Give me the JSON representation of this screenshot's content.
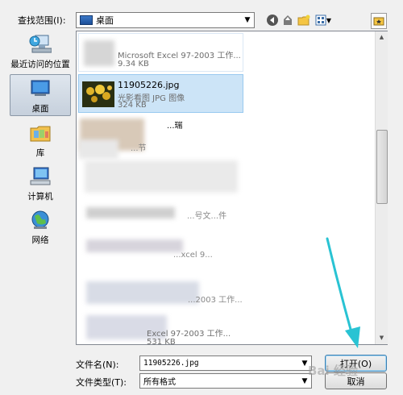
{
  "top": {
    "lookin_label": "查找范围(I):",
    "lookin_value": "桌面"
  },
  "places": [
    {
      "label": "最近访问的位置"
    },
    {
      "label": "桌面"
    },
    {
      "label": "库"
    },
    {
      "label": "计算机"
    },
    {
      "label": "网络"
    }
  ],
  "files": [
    {
      "name": "",
      "type": "Microsoft Excel 97-2003 工作...",
      "size": "9.34 KB"
    },
    {
      "name": "11905226.jpg",
      "type": "光影看图 JPG 图像",
      "size": "324 KB"
    },
    {
      "name": "",
      "type": "...瑞",
      "size": ""
    },
    {
      "name": "",
      "type": "...节",
      "size": ""
    },
    {
      "name": "",
      "type": "...号文...件",
      "size": ""
    },
    {
      "name": "",
      "type": "...xcel 9...",
      "size": ""
    },
    {
      "name": "",
      "type": "...2003 工作...",
      "size": ""
    },
    {
      "name": "",
      "type": "Excel 97-2003 工作...",
      "size": "531 KB"
    }
  ],
  "bottom": {
    "filename_label": "文件名(N):",
    "filename_value": "11905226.jpg",
    "filetype_label": "文件类型(T):",
    "filetype_value": "所有格式",
    "open_button": "打开(O)",
    "cancel_button": "取消"
  },
  "colors": {
    "selection": "#cce4f7",
    "annotation_arrow": "#29c3d3"
  },
  "watermark": "Bai 经验"
}
